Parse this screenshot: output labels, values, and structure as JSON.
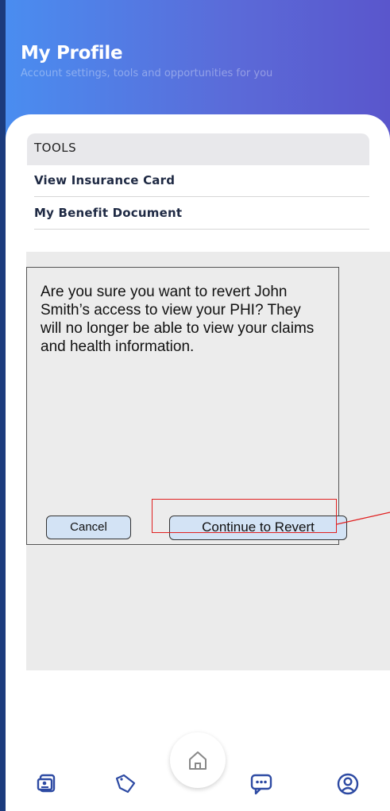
{
  "header": {
    "title": "My Profile",
    "subtitle": "Account settings, tools and opportunities for you"
  },
  "tools": {
    "section_label": "TOOLS",
    "items": [
      {
        "label": "View Insurance Card"
      },
      {
        "label": "My Benefit Document"
      }
    ]
  },
  "dialog": {
    "message": "Are you sure you want to revert John Smith’s access to view your PHI? They will no longer be able to view your claims and health information.",
    "cancel_label": "Cancel",
    "continue_label": "Continue to Revert"
  },
  "tabbar": {
    "items": [
      {
        "icon": "id-card-icon"
      },
      {
        "icon": "tag-icon"
      },
      {
        "icon": "home-icon"
      },
      {
        "icon": "chat-icon"
      },
      {
        "icon": "profile-icon"
      }
    ]
  },
  "colors": {
    "header_gradient_start": "#4a8df0",
    "header_gradient_end": "#5a56cc",
    "highlight": "#e02020",
    "button_fill": "#d3e3f5",
    "tab_icon": "#2d4aa3"
  }
}
